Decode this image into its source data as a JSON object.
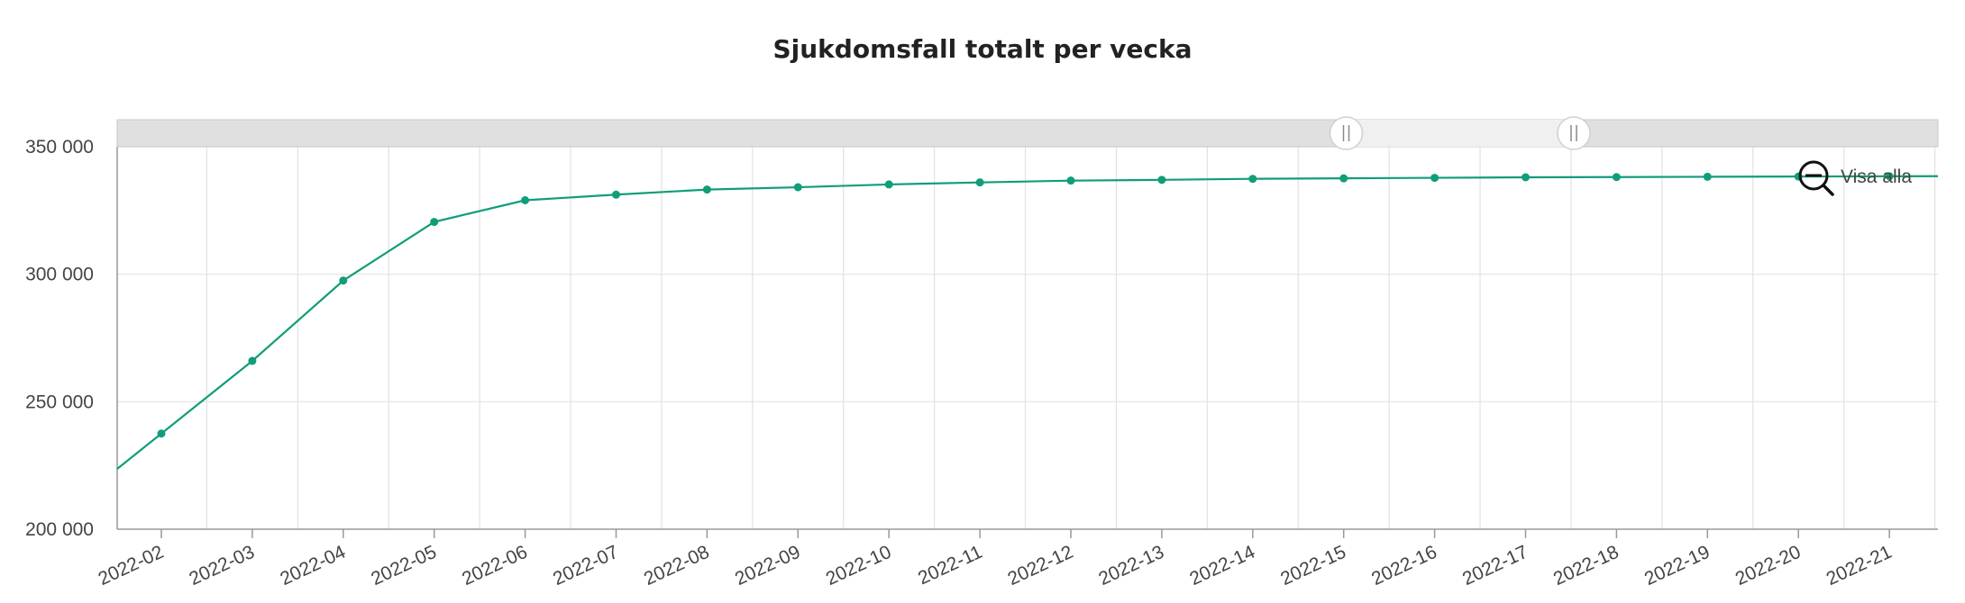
{
  "zoom_out_button": {
    "label": "Visa alla",
    "icon": "zoom-out-icon"
  },
  "scrollbar": {
    "range_start": 0.675,
    "range_end": 0.8
  },
  "colors": {
    "series": "#109d7a",
    "grid": "#e2e2e2",
    "scrollbar_track": "#e0e0e0",
    "scrollbar_thumb": "#f0f0f0"
  },
  "chart_data": {
    "type": "line",
    "title": "Sjukdomsfall totalt per vecka",
    "xlabel": "",
    "ylabel": "",
    "grid": true,
    "categories": [
      "2022-02",
      "2022-03",
      "2022-04",
      "2022-05",
      "2022-06",
      "2022-07",
      "2022-08",
      "2022-09",
      "2022-10",
      "2022-11",
      "2022-12",
      "2022-13",
      "2022-14",
      "2022-15",
      "2022-16",
      "2022-17",
      "2022-18",
      "2022-19",
      "2022-20",
      "2022-21"
    ],
    "y_ticks": [
      {
        "value": 200000,
        "label": "200 000"
      },
      {
        "value": 250000,
        "label": "250 000"
      },
      {
        "value": 300000,
        "label": "300 000"
      },
      {
        "value": 350000,
        "label": "350 000"
      }
    ],
    "ylim": [
      200000,
      350000
    ],
    "series": [
      {
        "values": [
          237500,
          266000,
          297500,
          320500,
          329000,
          331200,
          333200,
          334100,
          335200,
          336000,
          336700,
          337000,
          337400,
          337600,
          337800,
          338000,
          338100,
          338200,
          338300,
          338400
        ]
      }
    ]
  }
}
